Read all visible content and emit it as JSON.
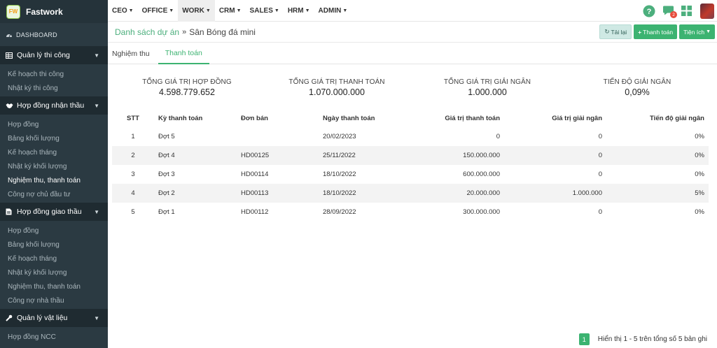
{
  "app": {
    "name": "Fastwork",
    "logo_text": "FW"
  },
  "sidebar": {
    "dashboard": "DASHBOARD",
    "groups": [
      {
        "title": "Quản lý thi công",
        "icon": "table-icon",
        "items": [
          "Kế hoạch thi công",
          "Nhật ký thi công"
        ]
      },
      {
        "title": "Hợp đồng nhận thầu",
        "icon": "handshake-icon",
        "items": [
          "Hợp đồng",
          "Bảng khối lượng",
          "Kế hoạch tháng",
          "Nhật ký khối lượng",
          "Nghiệm thu, thanh toán",
          "Công nợ chủ đầu tư"
        ]
      },
      {
        "title": "Hợp đồng giao thầu",
        "icon": "document-icon",
        "items": [
          "Hợp đồng",
          "Bảng khối lượng",
          "Kế hoạch tháng",
          "Nhật ký khối lượng",
          "Nghiệm thu, thanh toán",
          "Công nợ nhà thầu"
        ]
      },
      {
        "title": "Quản lý vật liệu",
        "icon": "wrench-icon",
        "items": [
          "Hợp đồng NCC"
        ]
      }
    ],
    "active_item": "Nghiệm thu, thanh toán"
  },
  "topnav": {
    "items": [
      "CEO",
      "OFFICE",
      "WORK",
      "CRM",
      "SALES",
      "HRM",
      "ADMIN"
    ],
    "active": "WORK",
    "notification_count": "2"
  },
  "breadcrumb": {
    "parent": "Danh sách dự án",
    "separator": "»",
    "current": "Sân Bóng đá mini"
  },
  "actions": {
    "reload": "Tải lại",
    "add_payment": "Thanh toán",
    "utilities": "Tiện ích"
  },
  "tabs": [
    {
      "label": "Nghiệm thu",
      "active": false
    },
    {
      "label": "Thanh toán",
      "active": true
    }
  ],
  "summary": [
    {
      "label": "TỔNG GIÁ TRỊ HỢP ĐỒNG",
      "value": "4.598.779.652"
    },
    {
      "label": "TỔNG GIÁ TRỊ THANH TOÁN",
      "value": "1.070.000.000"
    },
    {
      "label": "TỔNG GIÁ TRỊ GIẢI NGÂN",
      "value": "1.000.000"
    },
    {
      "label": "TIẾN ĐỘ GIẢI NGÂN",
      "value": "0,09%"
    }
  ],
  "table": {
    "columns": [
      "STT",
      "Kỳ thanh toán",
      "Đơn bán",
      "Ngày thanh toán",
      "Giá trị thanh toán",
      "Giá trị giải ngân",
      "Tiến độ giải ngân"
    ],
    "rows": [
      [
        "1",
        "Đợt 5",
        "",
        "20/02/2023",
        "0",
        "0",
        "0%"
      ],
      [
        "2",
        "Đợt 4",
        "HD00125",
        "25/11/2022",
        "150.000.000",
        "0",
        "0%"
      ],
      [
        "3",
        "Đợt 3",
        "HD00114",
        "18/10/2022",
        "600.000.000",
        "0",
        "0%"
      ],
      [
        "4",
        "Đợt 2",
        "HD00113",
        "18/10/2022",
        "20.000.000",
        "1.000.000",
        "5%"
      ],
      [
        "5",
        "Đợt 1",
        "HD00112",
        "28/09/2022",
        "300.000.000",
        "0",
        "0%"
      ]
    ]
  },
  "pagination": {
    "current_page": "1",
    "info": "Hiển thị 1 - 5 trên tổng số 5 bản ghi"
  },
  "colors": {
    "accent": "#3cb371",
    "sidebar_bg": "#2b3a42",
    "link": "#4caf7d"
  }
}
